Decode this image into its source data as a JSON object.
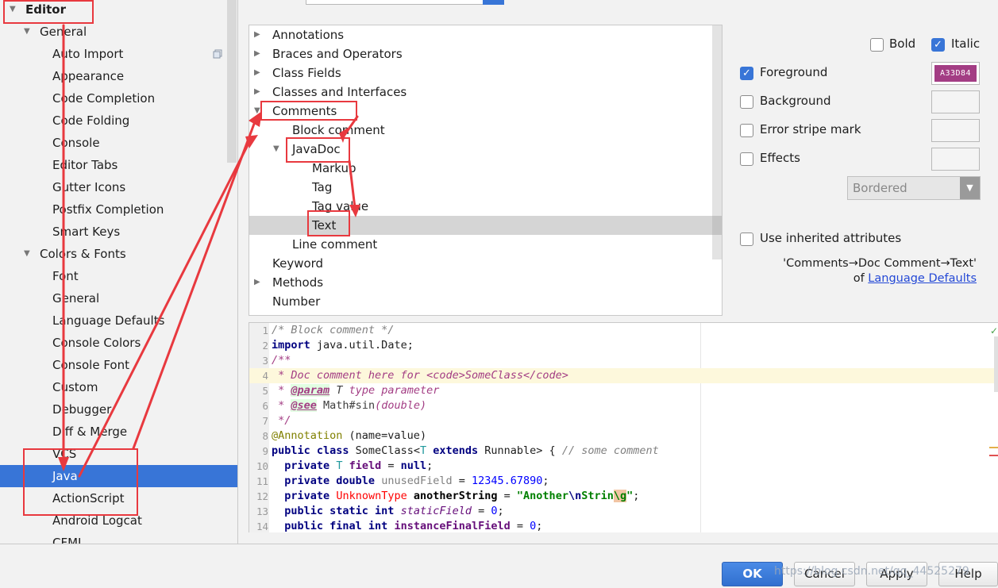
{
  "sidebar": {
    "items": [
      {
        "label": "Editor",
        "level": 0,
        "expanded": true,
        "bold": true
      },
      {
        "label": "General",
        "level": 1,
        "expanded": true
      },
      {
        "label": "Auto Import",
        "level": 2
      },
      {
        "label": "Appearance",
        "level": 2
      },
      {
        "label": "Code Completion",
        "level": 2
      },
      {
        "label": "Code Folding",
        "level": 2
      },
      {
        "label": "Console",
        "level": 2
      },
      {
        "label": "Editor Tabs",
        "level": 2
      },
      {
        "label": "Gutter Icons",
        "level": 2
      },
      {
        "label": "Postfix Completion",
        "level": 2
      },
      {
        "label": "Smart Keys",
        "level": 2
      },
      {
        "label": "Colors & Fonts",
        "level": 1,
        "expanded": true
      },
      {
        "label": "Font",
        "level": 2
      },
      {
        "label": "General",
        "level": 2
      },
      {
        "label": "Language Defaults",
        "level": 2
      },
      {
        "label": "Console Colors",
        "level": 2
      },
      {
        "label": "Console Font",
        "level": 2
      },
      {
        "label": "Custom",
        "level": 2
      },
      {
        "label": "Debugger",
        "level": 2
      },
      {
        "label": "Diff & Merge",
        "level": 2
      },
      {
        "label": "VCS",
        "level": 2
      },
      {
        "label": "Java",
        "level": 2,
        "selected": true
      },
      {
        "label": "ActionScript",
        "level": 2
      },
      {
        "label": "Android Logcat",
        "level": 2
      },
      {
        "label": "CFML",
        "level": 2
      }
    ]
  },
  "attributes_tree": {
    "items": [
      {
        "label": "Annotations",
        "level": 0,
        "arrow": "collapsed"
      },
      {
        "label": "Braces and Operators",
        "level": 0,
        "arrow": "collapsed"
      },
      {
        "label": "Class Fields",
        "level": 0,
        "arrow": "collapsed"
      },
      {
        "label": "Classes and Interfaces",
        "level": 0,
        "arrow": "collapsed"
      },
      {
        "label": "Comments",
        "level": 0,
        "arrow": "expanded"
      },
      {
        "label": "Block comment",
        "level": 1,
        "arrow": "none"
      },
      {
        "label": "JavaDoc",
        "level": 1,
        "arrow": "expanded"
      },
      {
        "label": "Markup",
        "level": 2,
        "arrow": "none"
      },
      {
        "label": "Tag",
        "level": 2,
        "arrow": "none"
      },
      {
        "label": "Tag value",
        "level": 2,
        "arrow": "none"
      },
      {
        "label": "Text",
        "level": 2,
        "arrow": "none",
        "selected": true
      },
      {
        "label": "Line comment",
        "level": 1,
        "arrow": "none"
      },
      {
        "label": "Keyword",
        "level": 0,
        "arrow": "none"
      },
      {
        "label": "Methods",
        "level": 0,
        "arrow": "collapsed"
      },
      {
        "label": "Number",
        "level": 0,
        "arrow": "none"
      }
    ]
  },
  "options": {
    "bold_label": "Bold",
    "bold_checked": false,
    "italic_label": "Italic",
    "italic_checked": true,
    "foreground_label": "Foreground",
    "foreground_checked": true,
    "foreground_color_text": "A33D84",
    "foreground_color": "#a33d84",
    "background_label": "Background",
    "background_checked": false,
    "error_stripe_label": "Error stripe mark",
    "error_stripe_checked": false,
    "effects_label": "Effects",
    "effects_checked": false,
    "effects_type": "Bordered",
    "inherit_label": "Use inherited attributes",
    "inherit_checked": false,
    "inherit_path": "'Comments→Doc Comment→Text'",
    "inherit_of": "of",
    "inherit_link": "Language Defaults"
  },
  "preview": {
    "current_line": 4,
    "line_numbers": [
      "1",
      "2",
      "3",
      "4",
      "5",
      "6",
      "7",
      "8",
      "9",
      "10",
      "11",
      "12",
      "13",
      "14"
    ]
  },
  "buttons": {
    "ok": "OK",
    "cancel": "Cancel",
    "apply": "Apply",
    "help": "Help"
  },
  "watermark": "https://blog.csdn.net/qq_44525279",
  "colors": {
    "selection": "#3875d7",
    "annotation_red": "#e8393f",
    "doc_comment": "#a33d84"
  }
}
